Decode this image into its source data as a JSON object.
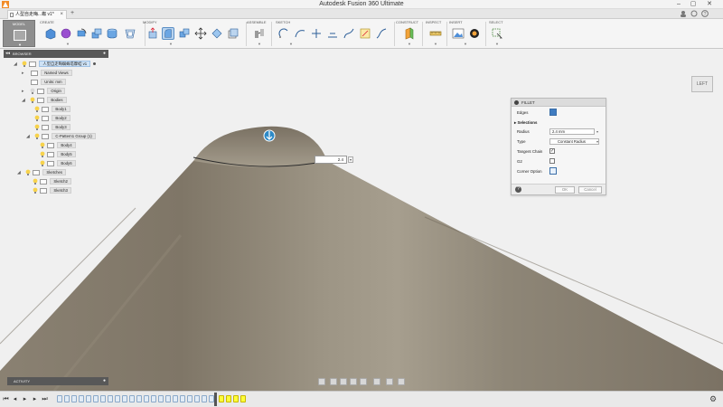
{
  "window": {
    "title": "Autodesk Fusion 360 Ultimate"
  },
  "tab": {
    "label": "人型自走晦...蜘 v1*"
  },
  "workspace": {
    "label": "MODEL"
  },
  "ribbon": {
    "groups": [
      "CREATE",
      "MODIFY",
      "ASSEMBLE",
      "SKETCH",
      "CONSTRUCT",
      "INSPECT",
      "INSERT",
      "SELECT"
    ]
  },
  "viewcube": {
    "label": "LEFT"
  },
  "browser": {
    "title": "BROWSER",
    "root": "人型自走晦蜘蛛塔摩蛙 v1",
    "named_views": "Named Views",
    "units": "Units: mm",
    "origin": "Origin",
    "bodies": "Bodies",
    "body1": "Body1",
    "body2": "Body2",
    "body3": "Body3",
    "pattern_group": "C-Pattern1 Group (1)",
    "body4": "Body4",
    "body5": "Body5",
    "body6": "Body6",
    "sketches": "Sketches",
    "sketch2": "Sketch2",
    "sketch3": "Sketch3"
  },
  "fillet": {
    "title": "FILLET",
    "edges_label": "Edges",
    "selections_label": "Selections",
    "radius_label": "Radius",
    "radius_value": "2.4 mm",
    "type_label": "Type",
    "type_value": "Constant Radius",
    "tangent_label": "Tangent Chain",
    "tangent_checked": true,
    "g2_label": "G2",
    "g2_checked": false,
    "corner_label": "Corner Option",
    "ok_label": "OK",
    "cancel_label": "Cancel"
  },
  "canvas_radius": {
    "value": "2.4"
  },
  "activity": {
    "label": "ACTIVITY"
  },
  "colors": {
    "accent": "#3f7cc1",
    "timeline_highlight": "#ffff3a",
    "model": "#8f8676"
  }
}
